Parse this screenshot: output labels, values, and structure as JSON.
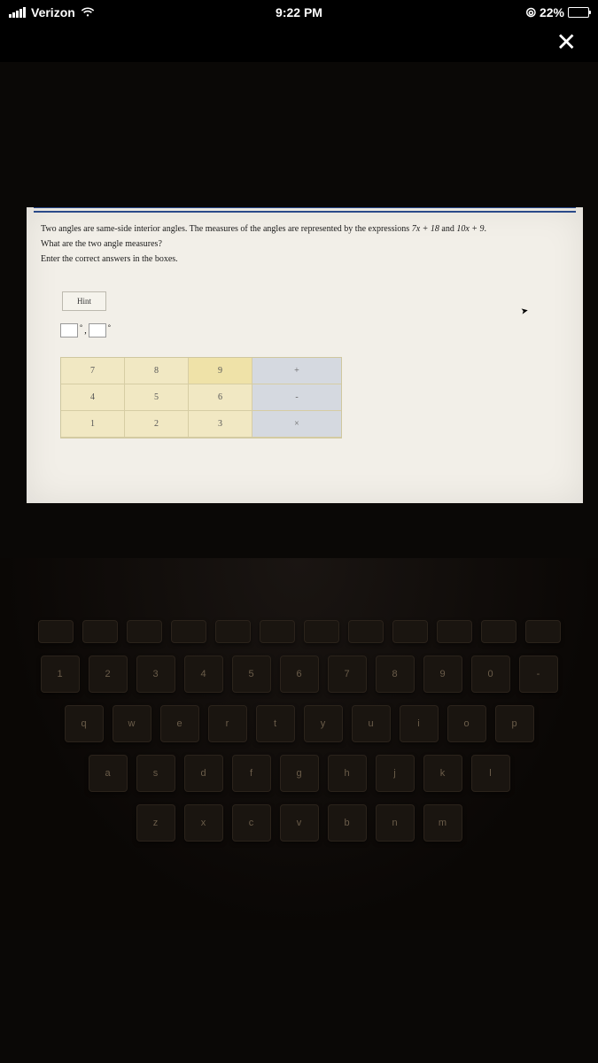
{
  "status": {
    "carrier": "Verizon",
    "time": "9:22 PM",
    "battery_pct": "22%"
  },
  "problem": {
    "line1_a": "Two angles are same-side interior angles. The measures of the angles are represented by the expressions ",
    "expr1": "7x + 18",
    "mid": " and ",
    "expr2": "10x + 9",
    "end": ".",
    "line2": "What are the two angle measures?",
    "line3": "Enter the correct answers in the boxes."
  },
  "hint_label": "Hint",
  "answers": {
    "sep": ", ",
    "deg": "°"
  },
  "keypad": {
    "rows": [
      [
        "7",
        "8",
        "9"
      ],
      [
        "4",
        "5",
        "6"
      ],
      [
        "1",
        "2",
        "3"
      ]
    ],
    "ops": [
      "+",
      "-",
      "×"
    ]
  },
  "keyboard": {
    "r2": [
      "1",
      "2",
      "3",
      "4",
      "5",
      "6",
      "7",
      "8",
      "9",
      "0",
      "-"
    ],
    "r3": [
      "q",
      "w",
      "e",
      "r",
      "t",
      "y",
      "u",
      "i",
      "o",
      "p"
    ],
    "r4": [
      "a",
      "s",
      "d",
      "f",
      "g",
      "h",
      "j",
      "k",
      "l"
    ],
    "r5": [
      "z",
      "x",
      "c",
      "v",
      "b",
      "n",
      "m"
    ]
  }
}
